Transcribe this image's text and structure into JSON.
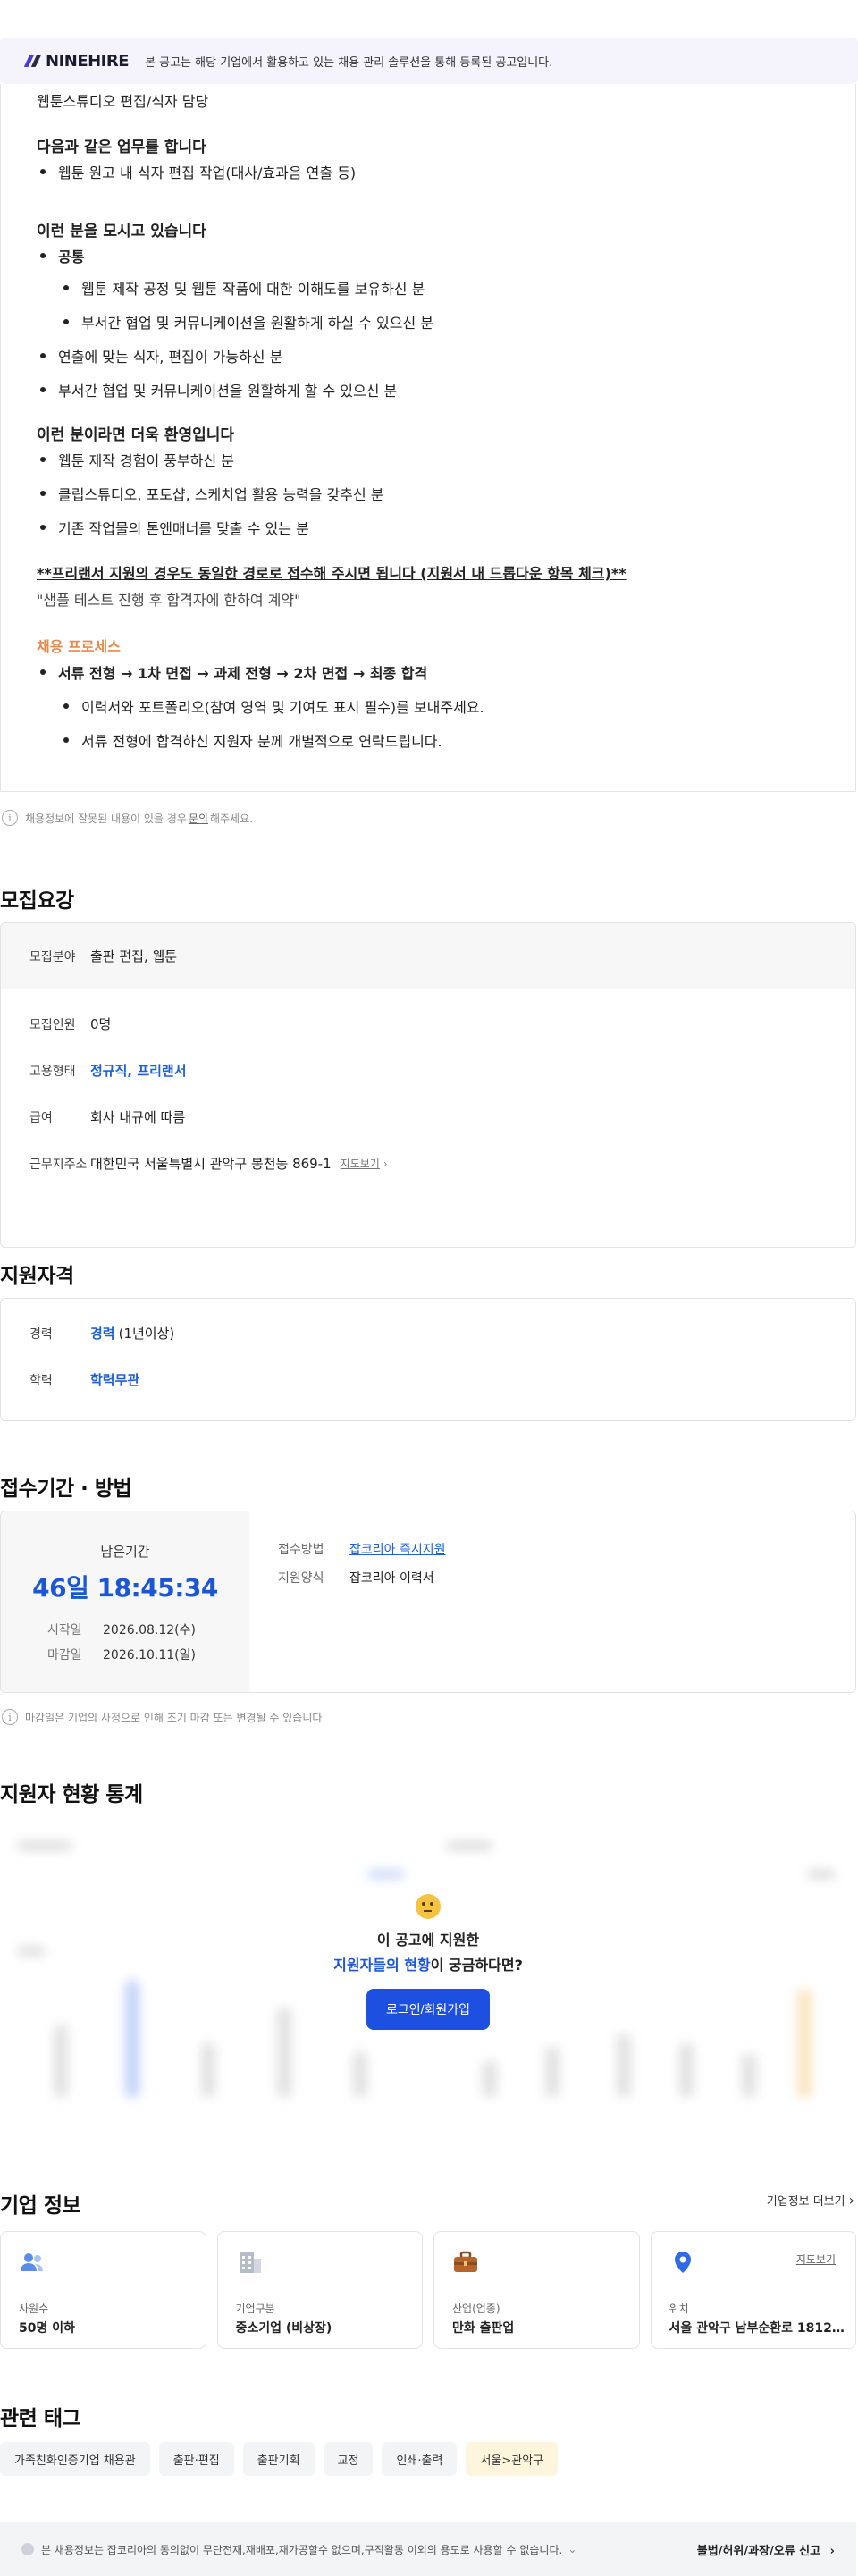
{
  "banner": {
    "brand": "NINEHIRE",
    "notice": "본 공고는 해당 기업에서 활용하고 있는 채용 관리 솔루션을 통해 등록된 공고입니다."
  },
  "detail": {
    "job_title": "웹툰스튜디오 편집/식자 담당",
    "duties_heading": "다음과 같은 업무를 합니다",
    "duties": [
      "웹툰 원고 내 식자 편집 작업(대사/효과음 연출 등)"
    ],
    "looking_heading": "이런 분을 모시고 있습니다",
    "common_label": "공통",
    "common_items": [
      "웹툰 제작 공정 및 웹툰 작품에 대한 이해도를 보유하신 분",
      "부서간 협업 및 커뮤니케이션을 원활하게 하실 수 있으신 분"
    ],
    "looking_items": [
      "연출에 맞는 식자, 편집이 가능하신 분",
      "부서간 협업 및 커뮤니케이션을 원활하게 할 수 있으신 분"
    ],
    "preferred_heading": "이런 분이라면 더욱 환영입니다",
    "preferred_items": [
      "웹툰 제작 경험이 풍부하신 분",
      "클립스튜디오, 포토샵, 스케치업 활용 능력을 갖추신 분",
      "기존 작업물의 톤앤매너를 맞출 수 있는 분"
    ],
    "freelancer_note": "**프리랜서 지원의 경우도 동일한 경로로 접수해 주시면 됩니다 (지원서 내 드롭다운 항목 체크)**",
    "sample_note": "\"샘플 테스트 진행 후 합격자에 한하여 계약\"",
    "process_heading": "채용 프로세스",
    "process_flow": "서류 전형 → 1차 면접 → 과제 전형 → 2차 면접 → 최종 합격",
    "process_items": [
      "이력서와 포트폴리오(참여 영역 및 기여도 표시 필수)를 보내주세요.",
      "서류 전형에 합격하신 지원자 분께 개별적으로 연락드립니다."
    ]
  },
  "report_note": {
    "before": "채용정보에 잘못된 내용이 있을 경우",
    "link": "문의",
    "after": "해주세요."
  },
  "requirements": {
    "title": "모집요강",
    "field_label": "모집분야",
    "field_value": "출판 편집, 웹툰",
    "headcount_label": "모집인원",
    "headcount_value": "0명",
    "employment_label": "고용형태",
    "employment_value": "정규직, 프리랜서",
    "salary_label": "급여",
    "salary_value": "회사 내규에 따름",
    "location_label": "근무지주소",
    "location_value": "대한민국 서울특별시 관악구 봉천동 869-1",
    "map_link": "지도보기"
  },
  "qualification": {
    "title": "지원자격",
    "career_label": "경력",
    "career_value": "경력",
    "career_detail": "(1년이상)",
    "education_label": "학력",
    "education_value": "학력무관"
  },
  "period": {
    "title": "접수기간 · 방법",
    "remaining_label": "남은기간",
    "remaining_value": "46일 18:45:34",
    "start_label": "시작일",
    "start_value": "2026.08.12(수)",
    "end_label": "마감일",
    "end_value": "2026.10.11(일)",
    "method_label": "접수방법",
    "method_value": "잡코리아 즉시지원",
    "form_label": "지원양식",
    "form_value": "잡코리아 이력서",
    "deadline_note": "마감일은 기업의 사정으로 인해 조기 마감 또는 변경될 수 있습니다"
  },
  "stats": {
    "title": "지원자 현황 통계",
    "question_line1": "이 공고에 지원한",
    "question_highlight": "지원자들의 현황",
    "question_suffix": "이 궁금하다면?",
    "login_button": "로그인/회원가입"
  },
  "company": {
    "title": "기업 정보",
    "more_link": "기업정보 더보기",
    "cards": [
      {
        "label": "사원수",
        "value": "50명 이하",
        "icon": "people-icon"
      },
      {
        "label": "기업구분",
        "value": "중소기업 (비상장)",
        "icon": "building-icon"
      },
      {
        "label": "산업(업종)",
        "value": "만화 출판업",
        "icon": "briefcase-icon"
      },
      {
        "label": "위치",
        "value": "서울 관악구 남부순환로 1812 (...",
        "icon": "location-pin-icon",
        "map_link": "지도보기"
      }
    ]
  },
  "tags": {
    "title": "관련 태그",
    "items": [
      "가족친화인증기업 채용관",
      "출판·편집",
      "출판기획",
      "교정",
      "인쇄·출력",
      "서울>관악구"
    ]
  },
  "footer": {
    "notice": "본 채용정보는 잡코리아의 동의없이 무단전재,재배포,재가공할수 없으며,구직활동 이외의 용도로 사용할 수 없습니다.",
    "report": "불법/허위/과장/오류 신고"
  },
  "colors": {
    "accent_blue": "#1d60d8",
    "button_blue": "#1d4fe0",
    "process_orange": "#e8894a",
    "banner_bg": "#f5f3fb"
  }
}
